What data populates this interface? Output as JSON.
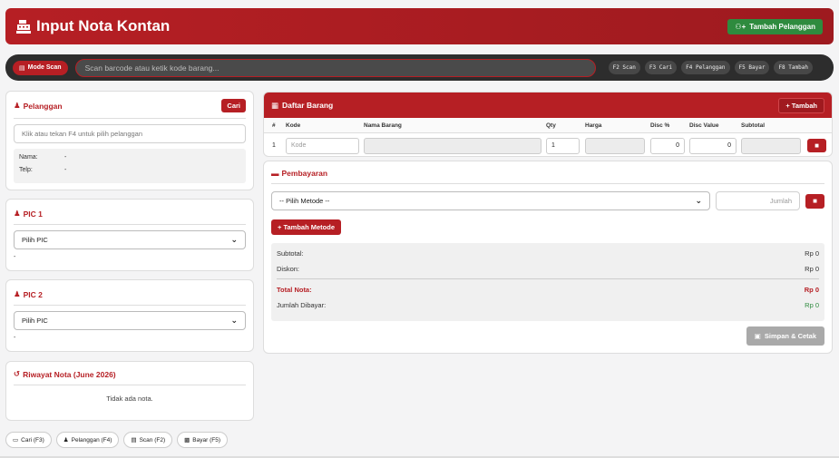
{
  "header": {
    "title": "Input Nota Kontan",
    "add_customer_label": "Tambah Pelanggan"
  },
  "scanbar": {
    "mode_label": "Mode Scan",
    "placeholder": "Scan barcode atau ketik kode barang...",
    "hotkeys": [
      "F2 Scan",
      "F3 Cari",
      "F4 Pelanggan",
      "F5 Bayar",
      "F8 Tambah"
    ]
  },
  "customer": {
    "title": "Pelanggan",
    "search_label": "Cari",
    "placeholder": "Klik atau tekan F4 untuk pilih pelanggan",
    "name_label": "Nama:",
    "name_value": "-",
    "phone_label": "Telp:",
    "phone_value": "-"
  },
  "pic1": {
    "title": "PIC 1",
    "selected": "Pilih PIC",
    "value": "-"
  },
  "pic2": {
    "title": "PIC 2",
    "selected": "Pilih PIC",
    "value": "-"
  },
  "history": {
    "title": "Riwayat Nota (June 2026)",
    "empty": "Tidak ada nota."
  },
  "shortcuts": [
    "Cari (F3)",
    "Pelanggan (F4)",
    "Scan (F2)",
    "Bayar (F5)"
  ],
  "items": {
    "title": "Daftar Barang",
    "add_label": "Tambah",
    "columns": [
      "#",
      "Kode",
      "Nama Barang",
      "Qty",
      "Harga",
      "Disc %",
      "Disc Value",
      "Subtotal"
    ],
    "row": {
      "no": "1",
      "code_placeholder": "Kode",
      "qty": "1",
      "disc_pct": "0",
      "disc_value": "0"
    }
  },
  "payment": {
    "title": "Pembayaran",
    "method_selected": "-- Pilih Metode --",
    "amount_placeholder": "Jumlah",
    "add_method_label": "Tambah Metode",
    "subtotal_label": "Subtotal:",
    "subtotal_value": "Rp 0",
    "discount_label": "Diskon:",
    "discount_value": "Rp 0",
    "total_label": "Total Nota:",
    "total_value": "Rp 0",
    "paid_label": "Jumlah Dibayar:",
    "paid_value": "Rp 0",
    "save_label": "Simpan & Cetak"
  },
  "colors": {
    "brand_red": "#b61f24",
    "green": "#2e8b3e"
  }
}
